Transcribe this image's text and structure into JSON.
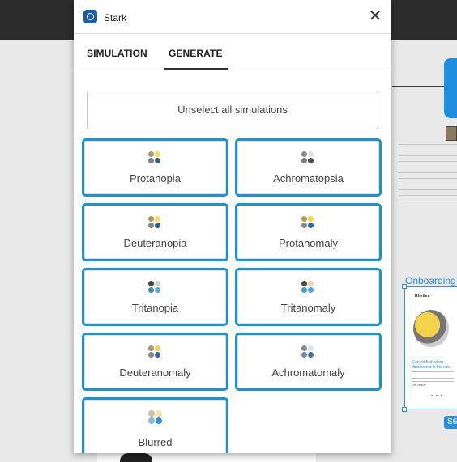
{
  "panel": {
    "title": "Stark",
    "icon": "stark-logo-icon",
    "close_icon": "close-icon"
  },
  "tabs": [
    {
      "label": "SIMULATION",
      "active": false
    },
    {
      "label": "GENERATE",
      "active": true
    }
  ],
  "unselect_label": "Unselect all simulations",
  "simulations": [
    {
      "label": "Protanopia",
      "selected": true,
      "dots": [
        "#a49a6a",
        "#f3df55",
        "#7f7f7f",
        "#3c5a8a"
      ]
    },
    {
      "label": "Achromatopsia",
      "selected": true,
      "dots": [
        "#8a8a8a",
        "#e2e2e2",
        "#7d7d7d",
        "#4a4a4a"
      ]
    },
    {
      "label": "Deuteranopia",
      "selected": true,
      "dots": [
        "#a59a63",
        "#f5dc5d",
        "#838383",
        "#2d5c94"
      ]
    },
    {
      "label": "Protanomaly",
      "selected": true,
      "dots": [
        "#b39d5a",
        "#f5d94a",
        "#888888",
        "#2f6aa8"
      ]
    },
    {
      "label": "Tritanopia",
      "selected": true,
      "dots": [
        "#444444",
        "#d0d0d0",
        "#3d8fb0",
        "#5aa8d8"
      ]
    },
    {
      "label": "Tritanomaly",
      "selected": true,
      "dots": [
        "#4b4b3a",
        "#e8d8b0",
        "#3c9ac5",
        "#4ea6e0"
      ]
    },
    {
      "label": "Deuteranomaly",
      "selected": true,
      "dots": [
        "#a6996b",
        "#f3d74f",
        "#858585",
        "#2f67a6"
      ]
    },
    {
      "label": "Achromatomaly",
      "selected": true,
      "dots": [
        "#8c8c8c",
        "#e6e6e6",
        "#6f8aa0",
        "#3a6f9e"
      ]
    },
    {
      "label": "Blurred",
      "selected": true,
      "dots": [
        "#c7c0a4",
        "#f1e6a8",
        "#8fb8d8",
        "#2f92d8"
      ]
    }
  ],
  "canvas": {
    "frame_label": "Onboarding",
    "frame_title": "Rhythm",
    "frame_heading": "Get notified when documents is the rule",
    "frame_next": "Get ready",
    "frame_dots": "• • •",
    "badge": "S6"
  },
  "colors": {
    "accent": "#1a93d6",
    "panel_bg": "#ffffff",
    "topbar": "#2c2c2c"
  }
}
